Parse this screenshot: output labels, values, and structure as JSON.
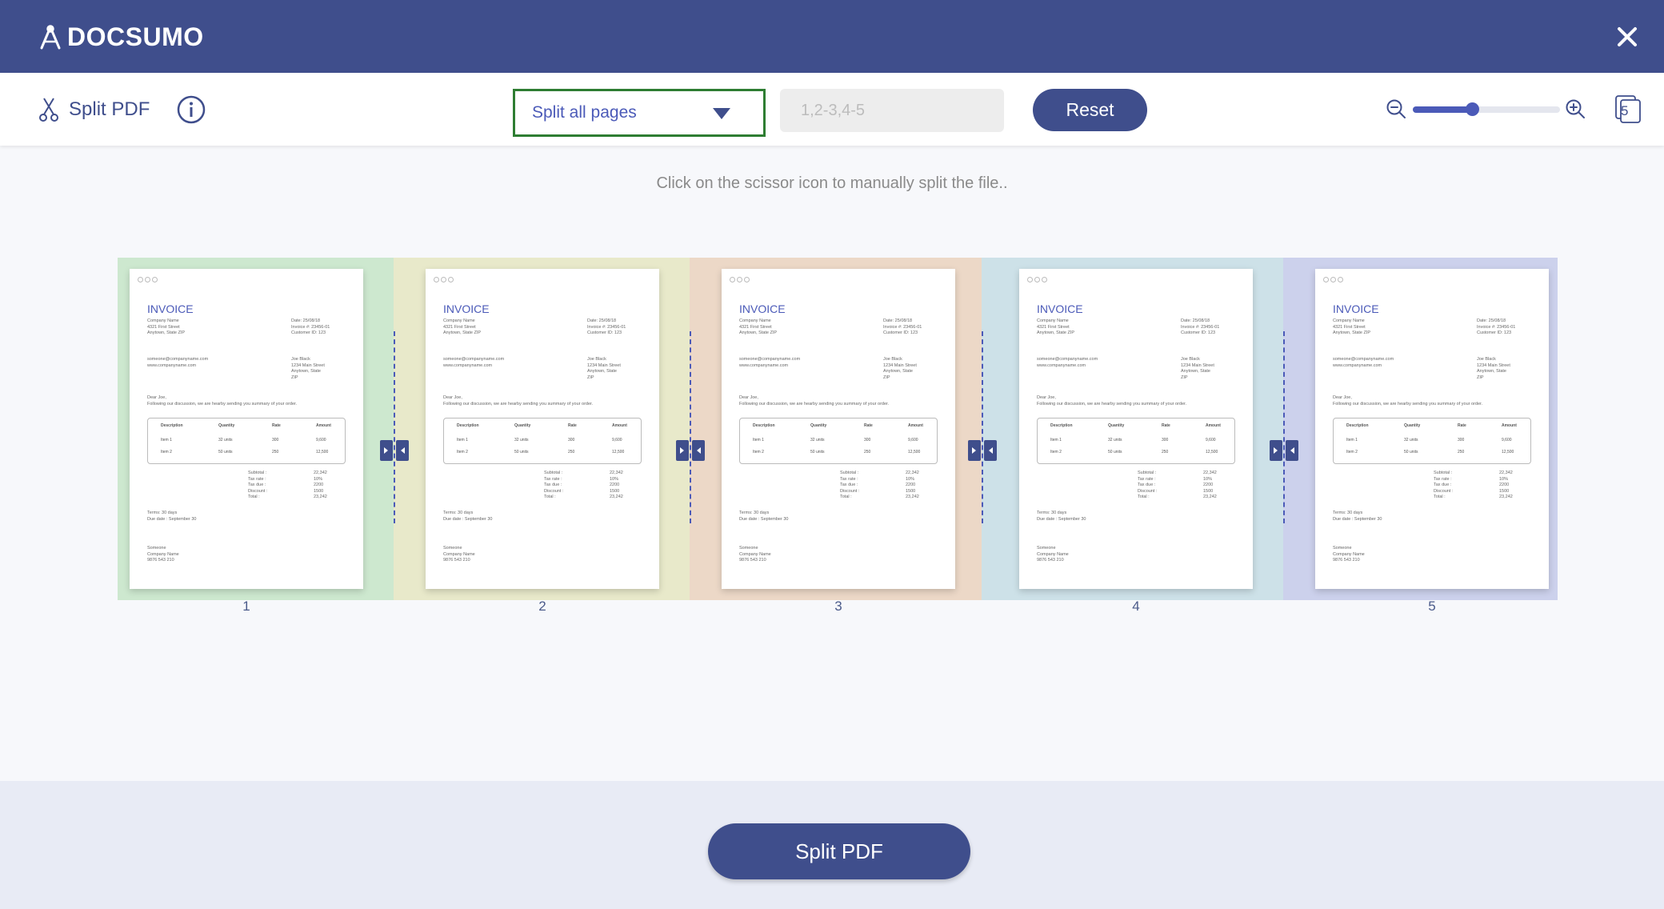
{
  "header": {
    "logo_text": "DOCSUMO",
    "close_icon": "close-icon",
    "background": "#3f4e8c"
  },
  "toolbar": {
    "tool_label": "Split PDF",
    "tool_icon": "scissors-icon",
    "info_icon": "info-icon",
    "split_mode": {
      "selected": "Split all pages",
      "icon": "caret-down-icon"
    },
    "range_input": {
      "placeholder": "1,2-3,4-5",
      "value": ""
    },
    "reset_label": "Reset",
    "zoom": {
      "level": 0.4,
      "zoom_out_icon": "zoom-out-icon",
      "zoom_in_icon": "zoom-in-icon"
    },
    "page_count": "5",
    "page_count_icon": "pages-icon"
  },
  "hint": "Click on the scissor icon to manually split the file..",
  "pages": [
    {
      "number": "1",
      "group_color": "#cde8cf"
    },
    {
      "number": "2",
      "group_color": "#e8e9ca"
    },
    {
      "number": "3",
      "group_color": "#ecd8c7"
    },
    {
      "number": "4",
      "group_color": "#cde1e8"
    },
    {
      "number": "5",
      "group_color": "#ccd1ec"
    }
  ],
  "invoice": {
    "title": "INVOICE",
    "from": "Company Name\n4321 First Street\nAnytown, State ZIP",
    "meta": "Date: 25/08/18\nInvoice #: 23456-01\nCustomer ID: 123",
    "contact": "someone@companyname.com\nwww.companyname.com",
    "to": "Joe Black\n1234 Main Street\nAnytown, State\nZIP",
    "greeting": "Dear Joe,\nFollowing our discussion, we are hearby sending you summary of your order.",
    "table_headers": [
      "Description",
      "Quantity",
      "Rate",
      "Amount"
    ],
    "table_rows": [
      [
        "Item 1",
        "32 units",
        "300",
        "9,600"
      ],
      [
        "Item 2",
        "50 units",
        "250",
        "12,500"
      ]
    ],
    "totals_labels": "Subtotal :\nTax rate :\nTax due :\nDiscount :\nTotal :",
    "totals_values": "22,342\n10%\n2200\n1500\n23,242",
    "terms": "Terms: 30 days\nDue date : September 30",
    "signature": "Someone\nCompany Name\n9876 543 210"
  },
  "footer": {
    "split_button_label": "Split PDF"
  }
}
